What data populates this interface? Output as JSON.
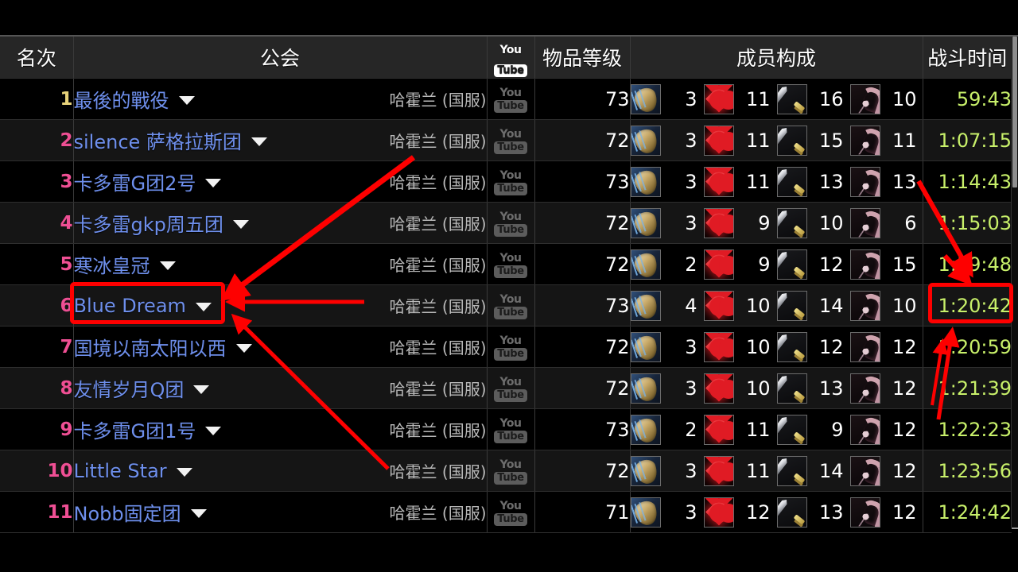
{
  "header": {
    "rank": "名次",
    "guild": "公会",
    "youtube_icon": "youtube-icon",
    "item_level": "物品等级",
    "composition": "成员构成",
    "fight_time": "战斗时间"
  },
  "youtube": {
    "top": "You",
    "bottom": "Tube"
  },
  "colors": {
    "guild_link": "#6e8fec",
    "rank_first": "#e8d37a",
    "rank_other": "#ef4f94",
    "time": "#c8f06a",
    "highlight": "#fe0000",
    "realm": "#b9b9b9"
  },
  "rows": [
    {
      "rank": "1",
      "guild": "最後的戰役",
      "realm": "哈霍兰 (国服)",
      "ilvl": "73",
      "tank": "3",
      "healer": "11",
      "melee": "16",
      "ranged": "10",
      "time": "59:43"
    },
    {
      "rank": "2",
      "guild": "silence 萨格拉斯团",
      "realm": "哈霍兰 (国服)",
      "ilvl": "72",
      "tank": "3",
      "healer": "11",
      "melee": "15",
      "ranged": "11",
      "time": "1:07:15"
    },
    {
      "rank": "3",
      "guild": "卡多雷G团2号",
      "realm": "哈霍兰 (国服)",
      "ilvl": "73",
      "tank": "3",
      "healer": "11",
      "melee": "13",
      "ranged": "13",
      "time": "1:14:43"
    },
    {
      "rank": "4",
      "guild": "卡多雷gkp周五团",
      "realm": "哈霍兰 (国服)",
      "ilvl": "72",
      "tank": "3",
      "healer": "9",
      "melee": "10",
      "ranged": "6",
      "time": "1:15:03"
    },
    {
      "rank": "5",
      "guild": "寒冰皇冠",
      "realm": "哈霍兰 (国服)",
      "ilvl": "72",
      "tank": "2",
      "healer": "9",
      "melee": "12",
      "ranged": "15",
      "time": "1:19:48"
    },
    {
      "rank": "6",
      "guild": "Blue Dream",
      "realm": "哈霍兰 (国服)",
      "ilvl": "73",
      "tank": "4",
      "healer": "10",
      "melee": "14",
      "ranged": "10",
      "time": "1:20:42"
    },
    {
      "rank": "7",
      "guild": "国境以南太阳以西",
      "realm": "哈霍兰 (国服)",
      "ilvl": "72",
      "tank": "3",
      "healer": "10",
      "melee": "12",
      "ranged": "12",
      "time": "1:20:59"
    },
    {
      "rank": "8",
      "guild": "友情岁月Q团",
      "realm": "哈霍兰 (国服)",
      "ilvl": "72",
      "tank": "3",
      "healer": "10",
      "melee": "13",
      "ranged": "12",
      "time": "1:21:39"
    },
    {
      "rank": "9",
      "guild": "卡多雷G团1号",
      "realm": "哈霍兰 (国服)",
      "ilvl": "73",
      "tank": "2",
      "healer": "11",
      "melee": "9",
      "ranged": "12",
      "time": "1:22:23"
    },
    {
      "rank": "10",
      "guild": "Little Star",
      "realm": "哈霍兰 (国服)",
      "ilvl": "72",
      "tank": "3",
      "healer": "11",
      "melee": "14",
      "ranged": "12",
      "time": "1:23:56"
    },
    {
      "rank": "11",
      "guild": "Nobb固定团",
      "realm": "哈霍兰 (国服)",
      "ilvl": "71",
      "tank": "3",
      "healer": "12",
      "melee": "13",
      "ranged": "12",
      "time": "1:24:42"
    }
  ],
  "annotations": {
    "highlighted_guild": "Blue Dream",
    "highlighted_time": "1:20:42",
    "arrow_count": 4
  }
}
